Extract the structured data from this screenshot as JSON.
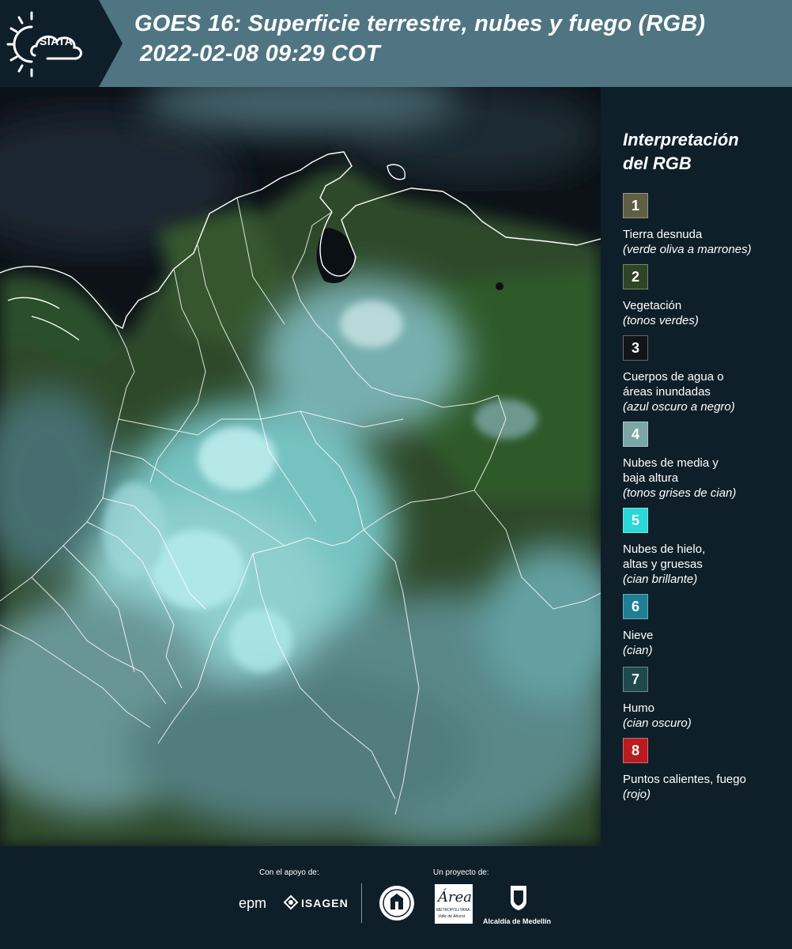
{
  "header": {
    "logo_text": "SIATA",
    "title_line1": "GOES 16: Superficie terrestre, nubes y fuego (RGB)",
    "title_line2": "2022-02-08 09:29 COT"
  },
  "legend": {
    "title_line1": "Interpretación",
    "title_line2": "del RGB",
    "items": [
      {
        "num": "1",
        "color": "#5f5f43",
        "label": [
          "Tierra desnuda"
        ],
        "note": "(verde oliva a marrones)"
      },
      {
        "num": "2",
        "color": "#2f4526",
        "label": [
          "Vegetación"
        ],
        "note": "(tonos verdes)"
      },
      {
        "num": "3",
        "color": "#111418",
        "label": [
          "Cuerpos de agua o",
          "áreas inundadas"
        ],
        "note": "(azul oscuro a negro)"
      },
      {
        "num": "4",
        "color": "#7aa6a6",
        "label": [
          "Nubes de media y",
          "baja altura"
        ],
        "note": "(tonos grises de cian)"
      },
      {
        "num": "5",
        "color": "#2ad9d6",
        "label": [
          "Nubes de hielo,",
          "altas y gruesas"
        ],
        "note": "(cian brillante)"
      },
      {
        "num": "6",
        "color": "#1f7f93",
        "label": [
          "Nieve"
        ],
        "note": "(cian)"
      },
      {
        "num": "7",
        "color": "#1e4a4e",
        "label": [
          "Humo"
        ],
        "note": "(cian oscuro)"
      },
      {
        "num": "8",
        "color": "#b81c20",
        "label": [
          "Puntos calientes, fuego"
        ],
        "note": "(rojo)"
      }
    ]
  },
  "footer": {
    "support_caption": "Con el apoyo de:",
    "project_caption": "Un proyecto de:",
    "logos": {
      "epm": "epm",
      "isagen": "ISAGEN",
      "area_main": "Área",
      "area_sub1": "METROPOLITANA",
      "area_sub2": "Valle de Aburrá",
      "alcaldia": "Alcaldía de Medellín"
    }
  },
  "colors": {
    "header_bg": "#4f7482",
    "logo_panel_bg": "#0e1f2a",
    "page_bg": "#0e1f2a",
    "ocean": "#0c1218",
    "vegetation": "#2e5a2c",
    "cloud_cyan": "#8fd6d9",
    "border_lines": "#ffffff"
  }
}
